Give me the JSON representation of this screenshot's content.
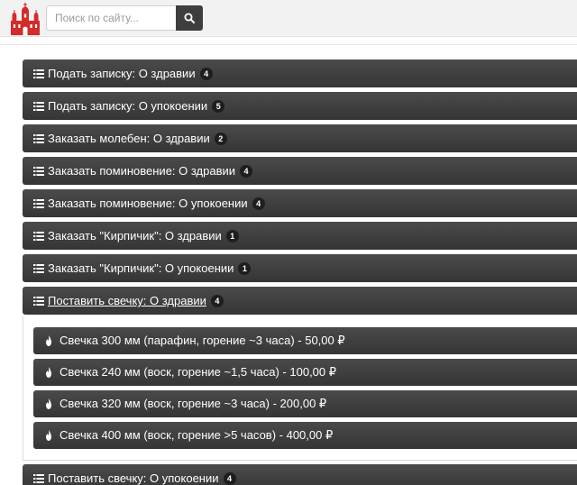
{
  "search": {
    "placeholder": "Поиск по сайту..."
  },
  "sections": [
    {
      "label": "Подать записку: О здравии",
      "count": "4"
    },
    {
      "label": "Подать записку: О упокоении",
      "count": "5"
    },
    {
      "label": "Заказать молебен: О здравии",
      "count": "2"
    },
    {
      "label": "Заказать поминовение: О здравии",
      "count": "4"
    },
    {
      "label": "Заказать поминовение: О упокоении",
      "count": "4"
    },
    {
      "label": "Заказать \"Кирпичик\": О здравии",
      "count": "1"
    },
    {
      "label": "Заказать \"Кирпичик\": О упокоении",
      "count": "1"
    },
    {
      "label": "Поставить свечку: О здравии",
      "count": "4"
    },
    {
      "label": "Поставить свечку: О упокоении",
      "count": "4"
    }
  ],
  "candles": [
    {
      "label": "Свечка 300 мм (парафин, горение ~3 часа) - 50,00 ₽"
    },
    {
      "label": "Свечка 240 мм (воск, горение ~1,5 часа) - 100,00 ₽"
    },
    {
      "label": "Свечка 320 мм (воск, горение ~3 часа) - 200,00 ₽"
    },
    {
      "label": "Свечка 400 мм (воск, горение >5 часов) - 400,00 ₽"
    }
  ],
  "colors": {
    "bar": "#3f3f3f",
    "logo": "#d42b2b"
  }
}
